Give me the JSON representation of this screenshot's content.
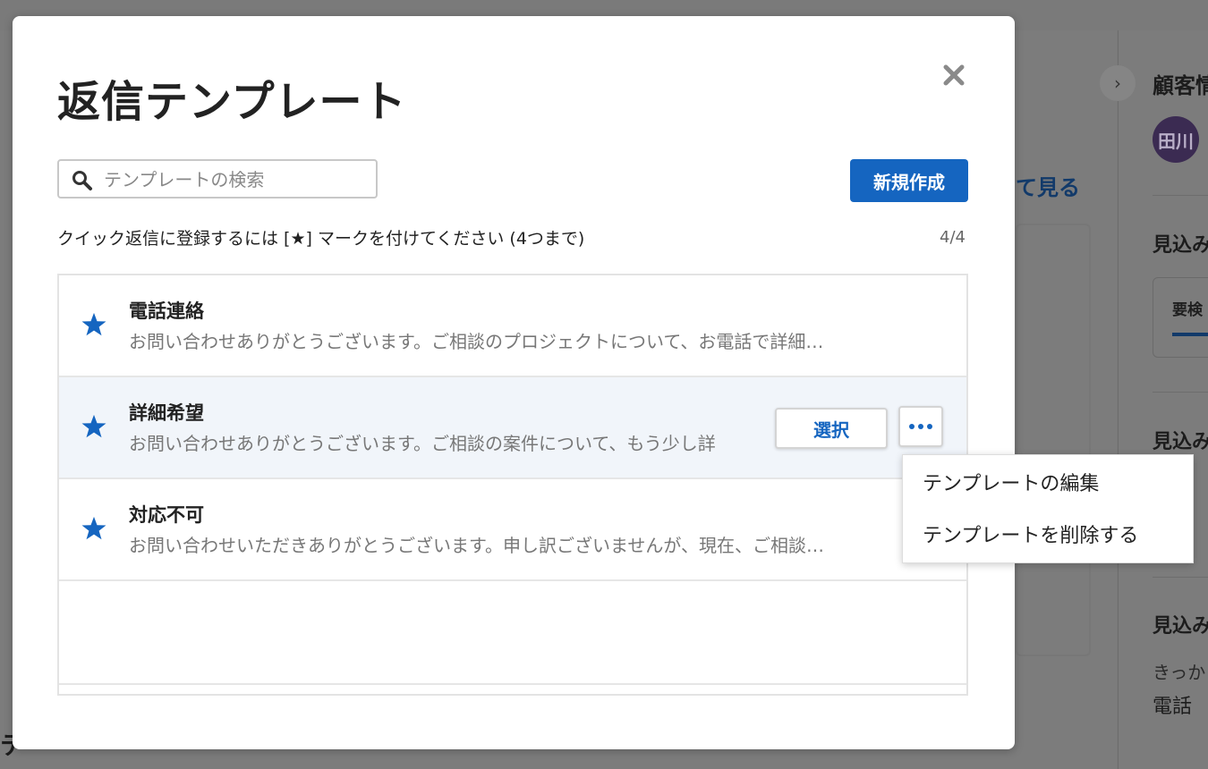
{
  "background": {
    "link_text": "て見る",
    "side_heading": "顧客情",
    "avatar_text": "田川",
    "side_section_1": "見込み",
    "side_section_2": "見込み",
    "side_section_3": "見込み",
    "status_label": "要検",
    "side_label": "きっか",
    "side_value": "電話",
    "bottom_text": "テ"
  },
  "modal": {
    "title": "返信テンプレート",
    "search_placeholder": "テンプレートの検索",
    "new_button": "新規作成",
    "hint": "クイック返信に登録するには [★] マークを付けてください (4つまで)",
    "count": "4/4",
    "templates": [
      {
        "title": "電話連絡",
        "preview": "お問い合わせありがとうございます。ご相談のプロジェクトについて、お電話で詳細…",
        "starred": true
      },
      {
        "title": "詳細希望",
        "preview": "お問い合わせありがとうございます。ご相談の案件について、もう少し詳",
        "starred": true
      },
      {
        "title": "対応不可",
        "preview": "お問い合わせいただきありがとうございます。申し訳ございませんが、現在、ご相談…",
        "starred": true
      }
    ],
    "row_actions": {
      "select": "選択",
      "more_icon": "more-horizontal-icon"
    },
    "menu": {
      "edit": "テンプレートの編集",
      "delete": "テンプレートを削除する"
    }
  },
  "colors": {
    "primary": "#1565c0",
    "star": "#1565c0"
  }
}
